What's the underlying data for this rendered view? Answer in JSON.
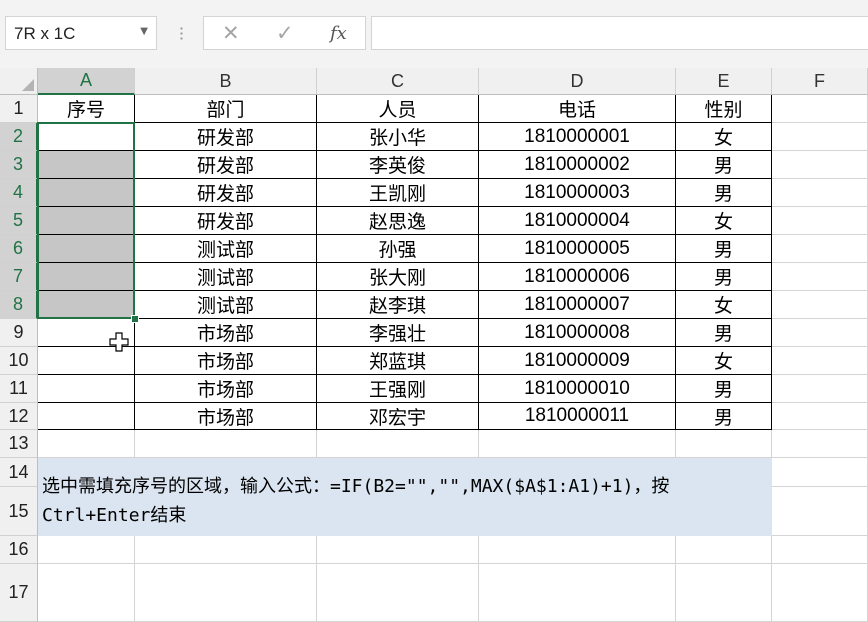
{
  "toolbar": {
    "name_box": "7R x 1C",
    "cancel_symbol": "✕",
    "enter_symbol": "✓",
    "fx_label": "fx",
    "formula": ""
  },
  "columns": [
    "A",
    "B",
    "C",
    "D",
    "E",
    "F"
  ],
  "rows": [
    "1",
    "2",
    "3",
    "4",
    "5",
    "6",
    "7",
    "8",
    "9",
    "10",
    "11",
    "12",
    "13",
    "14",
    "15",
    "16",
    "17"
  ],
  "headers": [
    "序号",
    "部门",
    "人员",
    "电话",
    "性别"
  ],
  "data": [
    [
      "",
      "研发部",
      "张小华",
      "1810000001",
      "女"
    ],
    [
      "",
      "研发部",
      "李英俊",
      "1810000002",
      "男"
    ],
    [
      "",
      "研发部",
      "王凯刚",
      "1810000003",
      "男"
    ],
    [
      "",
      "研发部",
      "赵思逸",
      "1810000004",
      "女"
    ],
    [
      "",
      "测试部",
      "孙强",
      "1810000005",
      "男"
    ],
    [
      "",
      "测试部",
      "张大刚",
      "1810000006",
      "男"
    ],
    [
      "",
      "测试部",
      "赵李琪",
      "1810000007",
      "女"
    ],
    [
      "",
      "市场部",
      "李强壮",
      "1810000008",
      "男"
    ],
    [
      "",
      "市场部",
      "郑蓝琪",
      "1810000009",
      "女"
    ],
    [
      "",
      "市场部",
      "王强刚",
      "1810000010",
      "男"
    ],
    [
      "",
      "市场部",
      "邓宏宇",
      "1810000011",
      "男"
    ]
  ],
  "note": "选中需填充序号的区域，输入公式：=IF(B2=\"\",\"\",MAX($A$1:A1)+1)，按\nCtrl+Enter结束",
  "colors": {
    "selection": "#217346",
    "note_bg": "#dbe5f1",
    "selected_fill": "#c6c6c6"
  }
}
